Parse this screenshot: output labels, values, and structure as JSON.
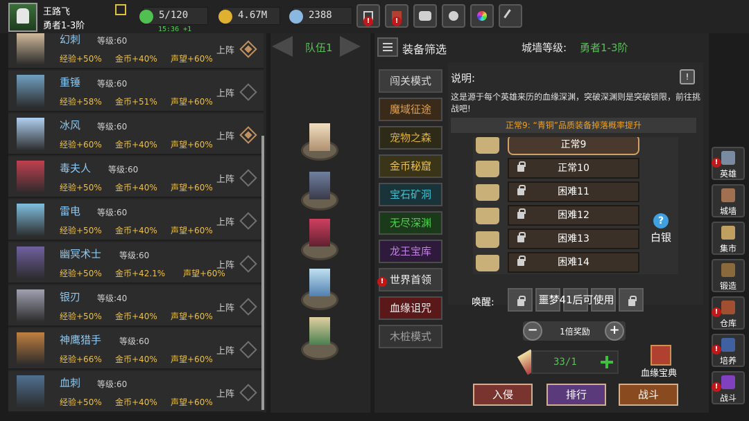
{
  "player": {
    "name": "王路飞",
    "rank": "勇者1-3阶"
  },
  "resources": {
    "energy": "5/120",
    "energy_timer": "15:36 +1",
    "gold": "4.67M",
    "gems": "2388"
  },
  "topbar_icons": [
    "shop-cart-icon",
    "map-icon",
    "gamepad-icon",
    "gear-icon",
    "color-wheel-icon",
    "quill-icon"
  ],
  "heroes": [
    {
      "name": "幻刺",
      "level_label": "等级:60",
      "stats": [
        "经验+50%",
        "金币+40%",
        "声望+60%"
      ],
      "deploy": "上阵",
      "active": true
    },
    {
      "name": "重锤",
      "level_label": "等级:60",
      "stats": [
        "经验+58%",
        "金币+51%",
        "声望+60%"
      ],
      "deploy": "上阵",
      "active": false
    },
    {
      "name": "冰风",
      "level_label": "等级:60",
      "stats": [
        "经验+60%",
        "金币+40%",
        "声望+60%"
      ],
      "deploy": "上阵",
      "active": true
    },
    {
      "name": "毒夫人",
      "level_label": "等级:60",
      "stats": [
        "经验+50%",
        "金币+40%",
        "声望+60%"
      ],
      "deploy": "上阵",
      "active": false
    },
    {
      "name": "雷电",
      "level_label": "等级:60",
      "stats": [
        "经验+50%",
        "金币+40%",
        "声望+60%"
      ],
      "deploy": "上阵",
      "active": false
    },
    {
      "name": "幽冥术士",
      "level_label": "等级:60",
      "stats": [
        "经验+50%",
        "金币+42.1%",
        "声望+60%"
      ],
      "deploy": "上阵",
      "active": false
    },
    {
      "name": "银刃",
      "level_label": "等级:40",
      "stats": [
        "经验+50%",
        "金币+40%",
        "声望+60%"
      ],
      "deploy": "上阵",
      "active": false
    },
    {
      "name": "神鹰猎手",
      "level_label": "等级:60",
      "stats": [
        "经验+66%",
        "金币+40%",
        "声望+60%"
      ],
      "deploy": "上阵",
      "active": false
    },
    {
      "name": "血刺",
      "level_label": "等级:60",
      "stats": [
        "经验+50%",
        "金币+40%",
        "声望+60%"
      ],
      "deploy": "上阵",
      "active": false
    }
  ],
  "team": {
    "label": "队伍1"
  },
  "header": {
    "filter_label": "装备筛选",
    "wall_label": "城墙等级:",
    "wall_value": "勇者1-3阶"
  },
  "modes": [
    {
      "label": "闯关模式",
      "color": "#d8d8d8",
      "bg": "#3c3c3c"
    },
    {
      "label": "魔域征途",
      "color": "#e0a050",
      "bg": "#3a2a1a"
    },
    {
      "label": "宠物之森",
      "color": "#e0b040",
      "bg": "#2e2a18"
    },
    {
      "label": "金币秘窟",
      "color": "#f0c040",
      "bg": "#3a3418"
    },
    {
      "label": "宝石矿洞",
      "color": "#40c0d0",
      "bg": "#183438"
    },
    {
      "label": "无尽深渊",
      "color": "#50d050",
      "bg": "#1a3a1a"
    },
    {
      "label": "龙王宝库",
      "color": "#c080e0",
      "bg": "#2e1a3a"
    },
    {
      "label": "世界首领",
      "color": "#f0f0f0",
      "bg": "#3a3a3a"
    },
    {
      "label": "血缘诅咒",
      "color": "#f0f0f0",
      "bg": "#5a1818"
    },
    {
      "label": "木桩模式",
      "color": "#a0a0a0",
      "bg": "#343434"
    }
  ],
  "description": {
    "title": "说明:",
    "text": "这是源于每个英雄来历的血缘深渊，突破深渊则是突破锁限，前往挑战吧!",
    "info": "正常9: “青铜”品质装备掉落概率提升"
  },
  "levels": [
    {
      "label": "正常9",
      "locked": false,
      "selected": true
    },
    {
      "label": "正常10",
      "locked": true,
      "selected": false
    },
    {
      "label": "困难11",
      "locked": true,
      "selected": false
    },
    {
      "label": "困难12",
      "locked": true,
      "selected": false
    },
    {
      "label": "困难13",
      "locked": true,
      "selected": false
    },
    {
      "label": "困难14",
      "locked": true,
      "selected": false
    }
  ],
  "reward_tier": {
    "icon": "question-icon",
    "glyph": "?",
    "label": "白银"
  },
  "awaken": {
    "label": "唤醒:",
    "text": "噩梦41后可使用"
  },
  "multiplier": {
    "minus": "−",
    "plus": "+",
    "label": "1倍奖励"
  },
  "tickets": {
    "count": "33/1"
  },
  "codex": {
    "label": "血缘宝典"
  },
  "actions": {
    "invade": "入侵",
    "rank": "排行",
    "battle": "战斗"
  },
  "sidebar": [
    {
      "label": "英雄",
      "icon": "helmet-icon",
      "alert": true
    },
    {
      "label": "城墙",
      "icon": "wall-icon",
      "alert": false
    },
    {
      "label": "集市",
      "icon": "market-icon",
      "alert": false
    },
    {
      "label": "锻造",
      "icon": "anvil-icon",
      "alert": false
    },
    {
      "label": "仓库",
      "icon": "chest-icon",
      "alert": true
    },
    {
      "label": "培养",
      "icon": "trophy-icon",
      "alert": true
    },
    {
      "label": "战斗",
      "icon": "portal-icon",
      "alert": true
    }
  ],
  "colors": {
    "accent_green": "#5ac05a",
    "stat_yellow": "#f0c040",
    "hero_name_blue": "#8ec8f0",
    "alert_red": "#c01818"
  }
}
